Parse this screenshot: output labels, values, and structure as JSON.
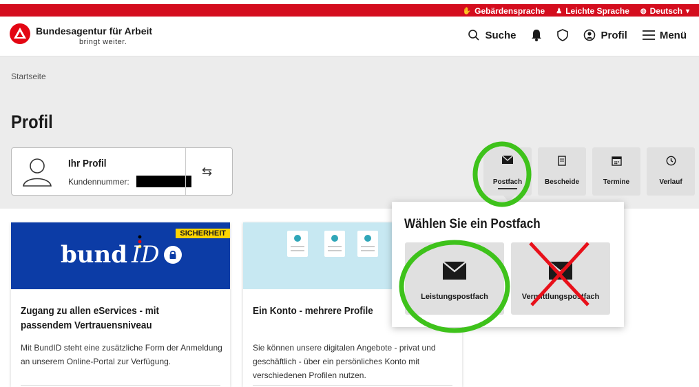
{
  "topbar": {
    "sign_language": "Gebärdensprache",
    "easy_language": "Leichte Sprache",
    "language": "Deutsch"
  },
  "header": {
    "brand": "Bundesagentur für Arbeit",
    "tagline": "bringt weiter.",
    "search": "Suche",
    "profile": "Profil",
    "menu": "Menü"
  },
  "breadcrumb": "Startseite",
  "page_title": "Profil",
  "profile_card": {
    "name": "Ihr Profil",
    "customer_label": "Kundennummer:"
  },
  "quick_tiles": [
    {
      "label": "Postfach",
      "icon": "envelope-icon"
    },
    {
      "label": "Bescheide",
      "icon": "document-icon"
    },
    {
      "label": "Termine",
      "icon": "calendar-icon"
    },
    {
      "label": "Verlauf",
      "icon": "clock-icon"
    }
  ],
  "cards": [
    {
      "badge": "SICHERHEIT",
      "logo_main": "bund",
      "logo_id": "ID",
      "title_line1": "Zugang zu allen eServices - mit",
      "title_line2": "passendem Vertrauensniveau",
      "body": "Mit BundID steht eine zusätzliche Form der Anmeldung an unserem Online-Portal zur Verfügung."
    },
    {
      "title": "Ein Konto - mehrere Profile",
      "body": "Sie können unsere digitalen Angebote - privat und geschäftlich - über ein persönliches Konto mit verschiedenen Profilen nutzen."
    }
  ],
  "dropdown": {
    "title": "Wählen Sie ein Postfach",
    "options": [
      {
        "label": "Leistungspostfach",
        "icon": "envelope-icon"
      },
      {
        "label": "Vermittlungspostfach",
        "icon": "envelope-icon"
      }
    ]
  },
  "colors": {
    "brand_red": "#d40d1e",
    "bund_blue": "#0c3ca6",
    "annotation_green": "#3ec21b",
    "annotation_red": "#e8101a"
  }
}
